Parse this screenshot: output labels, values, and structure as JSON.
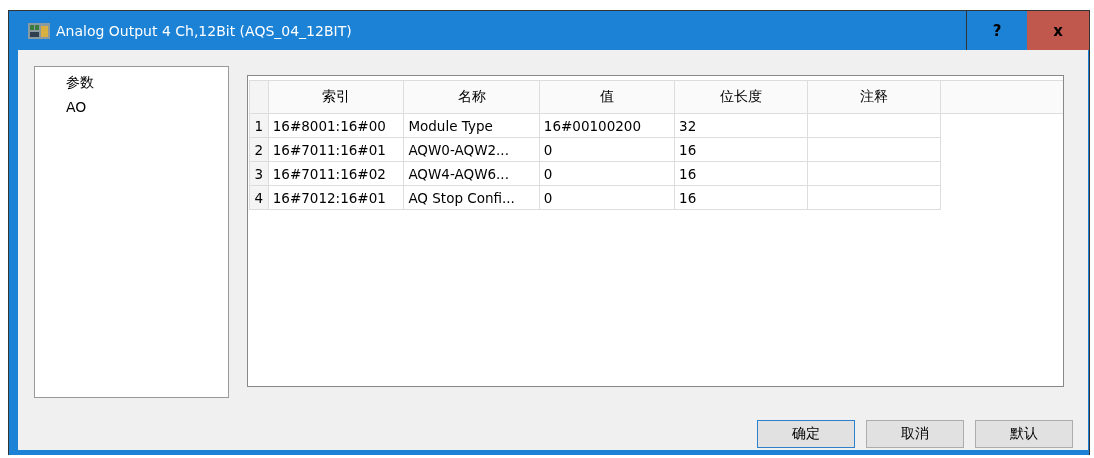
{
  "window": {
    "title": "Analog  Output 4 Ch,12Bit (AQS_04_12BIT)",
    "help": "?",
    "close": "x"
  },
  "sidebar": {
    "items": [
      {
        "label": "参数"
      },
      {
        "label": "AO"
      }
    ]
  },
  "table": {
    "columns": [
      "索引",
      "名称",
      "值",
      "位长度",
      "注释"
    ],
    "rows": [
      {
        "number": "1",
        "cells": [
          "16#8001:16#00",
          "Module Type",
          "16#00100200",
          "32",
          ""
        ]
      },
      {
        "number": "2",
        "cells": [
          "16#7011:16#01",
          "AQW0-AQW2...",
          "0",
          "16",
          ""
        ]
      },
      {
        "number": "3",
        "cells": [
          "16#7011:16#02",
          "AQW4-AQW6...",
          "0",
          "16",
          ""
        ]
      },
      {
        "number": "4",
        "cells": [
          "16#7012:16#01",
          "AQ Stop Confi...",
          "0",
          "16",
          ""
        ]
      }
    ]
  },
  "buttons": [
    {
      "label": "确定",
      "default": true
    },
    {
      "label": "取消",
      "default": false
    },
    {
      "label": "默认",
      "default": false
    }
  ]
}
